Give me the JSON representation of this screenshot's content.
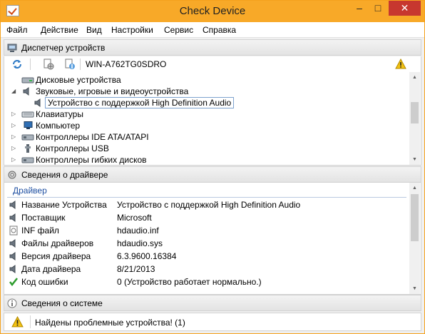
{
  "window": {
    "title": "Check Device",
    "minimize": "–",
    "maximize": "□",
    "close": "✕"
  },
  "menu": [
    "Файл",
    "Действие",
    "Вид",
    "Настройки",
    "Сервис",
    "Справка"
  ],
  "device_manager": {
    "header": "Диспетчер устройств",
    "computer_name": "WIN-A762TG0SDRO",
    "tree": [
      {
        "label": "Дисковые устройства",
        "expander": "",
        "icon": "disk-drive-icon"
      },
      {
        "label": "Звуковые, игровые и видеоустройства",
        "expander": "◢",
        "icon": "speaker-icon"
      },
      {
        "label": "Устройство с поддержкой High Definition Audio",
        "expander": "",
        "icon": "speaker-icon"
      },
      {
        "label": "Клавиатуры",
        "expander": "▷",
        "icon": "keyboard-icon"
      },
      {
        "label": "Компьютер",
        "expander": "▷",
        "icon": "computer-icon"
      },
      {
        "label": "Контроллеры IDE ATA/ATAPI",
        "expander": "▷",
        "icon": "controller-icon"
      },
      {
        "label": "Контроллеры USB",
        "expander": "▷",
        "icon": "usb-icon"
      },
      {
        "label": "Контроллеры гибких дисков",
        "expander": "▷",
        "icon": "controller-icon"
      }
    ]
  },
  "driver_info": {
    "header": "Сведения о драйвере",
    "group": "Драйвер",
    "properties": [
      {
        "name": "Название Устройства",
        "value": "Устройство с поддержкой High Definition Audio",
        "icon": "speaker-icon"
      },
      {
        "name": "Поставщик",
        "value": "Microsoft",
        "icon": "speaker-icon"
      },
      {
        "name": "INF файл",
        "value": "hdaudio.inf",
        "icon": "inf-file-icon"
      },
      {
        "name": "Файлы драйверов",
        "value": "hdaudio.sys",
        "icon": "speaker-icon"
      },
      {
        "name": "Версия драйвера",
        "value": "6.3.9600.16384",
        "icon": "speaker-icon"
      },
      {
        "name": "Дата драйвера",
        "value": "8/21/2013",
        "icon": "speaker-icon"
      },
      {
        "name": "Код ошибки",
        "value": "0 (Устройство работает нормально.)",
        "icon": "checkmark-icon"
      }
    ]
  },
  "system_info": {
    "header": "Сведения о системе"
  },
  "status": {
    "text": "Найдены проблемные устройства!  (1)"
  },
  "colors": {
    "titlebar": "#f8a928",
    "close": "#c7372f",
    "group_label": "#1e4fa1",
    "warning": "#f3c212"
  }
}
